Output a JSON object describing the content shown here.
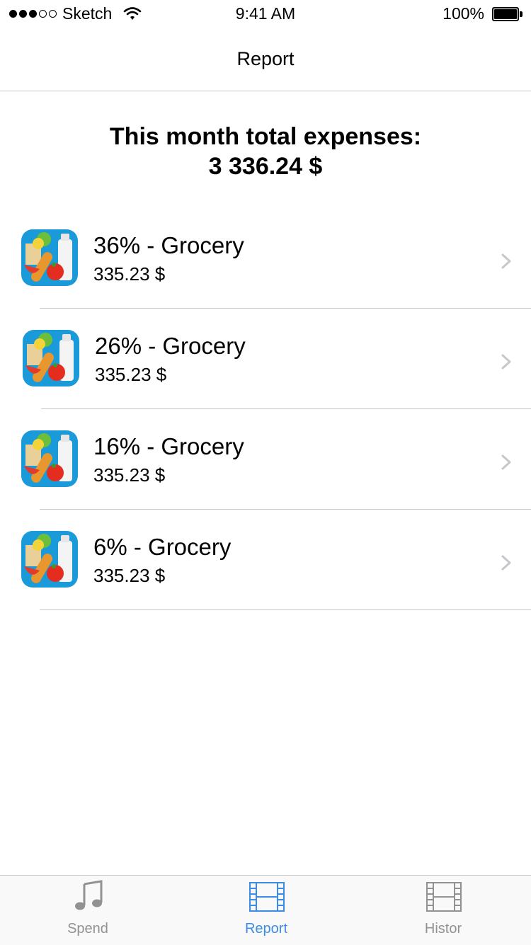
{
  "status_bar": {
    "carrier": "Sketch",
    "time": "9:41 AM",
    "battery": "100%",
    "signal_bars_filled": 3,
    "signal_bars_total": 5
  },
  "nav": {
    "title": "Report"
  },
  "summary": {
    "line1": "This month total expenses:",
    "line2": "3 336.24 $"
  },
  "expenses": [
    {
      "title": "36% - Grocery",
      "amount": "335.23 $",
      "icon": "grocery-icon"
    },
    {
      "title": "26% - Grocery",
      "amount": "335.23 $",
      "icon": "grocery-icon"
    },
    {
      "title": "16% - Grocery",
      "amount": "335.23 $",
      "icon": "grocery-icon"
    },
    {
      "title": "6% - Grocery",
      "amount": "335.23 $",
      "icon": "grocery-icon"
    }
  ],
  "tabs": [
    {
      "label": "Spend",
      "icon": "music-note-icon",
      "active": false
    },
    {
      "label": "Report",
      "icon": "film-icon",
      "active": true
    },
    {
      "label": "Histor",
      "icon": "film-icon",
      "active": false
    }
  ],
  "colors": {
    "accent": "#3c8ce6",
    "separator": "#c8c7cc",
    "inactive_tab": "#929292",
    "icon_background": "#1a9ad8"
  }
}
